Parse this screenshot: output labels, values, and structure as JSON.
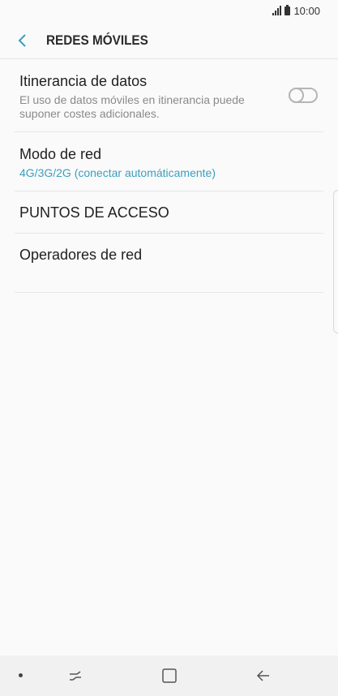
{
  "status": {
    "time": "10:00"
  },
  "header": {
    "title": "REDES MÓVILES"
  },
  "settings": {
    "roaming": {
      "title": "Itinerancia de datos",
      "description": "El uso de datos móviles en itinerancia puede suponer costes adicionales.",
      "enabled": false
    },
    "network_mode": {
      "title": "Modo de red",
      "value": "4G/3G/2G (conectar automáticamente)"
    },
    "access_points": {
      "title": "PUNTOS DE ACCESO"
    },
    "operators": {
      "title": "Operadores de red"
    }
  },
  "colors": {
    "accent": "#3a9fbf",
    "background": "#fafafa"
  }
}
